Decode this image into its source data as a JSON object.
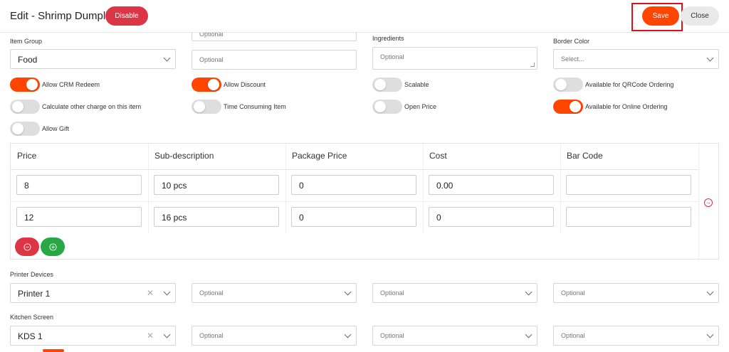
{
  "header": {
    "title": "Edit - Shrimp Dumpling",
    "disable_label": "Disable",
    "save_label": "Save",
    "close_label": "Close"
  },
  "form": {
    "item_group_label": "Item Group",
    "item_group_value": "Food",
    "optional_top_placeholder": "Optional",
    "optional_mid_placeholder": "Optional",
    "ingredients_label": "Ingredients",
    "ingredients_placeholder": "Optional",
    "border_color_label": "Border Color",
    "border_color_placeholder": "Select..."
  },
  "toggles": [
    {
      "label": "Allow CRM Redeem",
      "on": true
    },
    {
      "label": "Allow Discount",
      "on": true
    },
    {
      "label": "Scalable",
      "on": false
    },
    {
      "label": "Available for QRCode Ordering",
      "on": false
    },
    {
      "label": "Calculate other charge on this item",
      "on": false
    },
    {
      "label": "Time Consuming Item",
      "on": false
    },
    {
      "label": "Open Price",
      "on": false
    },
    {
      "label": "Available for Online Ordering",
      "on": true
    },
    {
      "label": "Allow Gift",
      "on": false
    }
  ],
  "price_table": {
    "headers": [
      "Price",
      "Sub-description",
      "Package Price",
      "Cost",
      "Bar Code"
    ],
    "rows": [
      [
        "8",
        "10 pcs",
        "0",
        "0.00",
        ""
      ],
      [
        "12",
        "16 pcs",
        "0",
        "0",
        ""
      ]
    ],
    "remove_icon": "minus-circle-icon",
    "add_icon": "plus-circle-icon",
    "arrow_icon": "arrow-right-circle-icon"
  },
  "printer": {
    "label": "Printer Devices",
    "value": "Printer 1",
    "optional_placeholders": [
      "Optional",
      "Optional",
      "Optional"
    ]
  },
  "kitchen": {
    "label": "Kitchen Screen",
    "value": "KDS 1",
    "optional_placeholders": [
      "Optional",
      "Optional",
      "Optional"
    ]
  },
  "colors": {
    "accent": "#ff4500",
    "danger": "#dc3545",
    "success": "#28a745",
    "toggle_off": "#dedede"
  }
}
